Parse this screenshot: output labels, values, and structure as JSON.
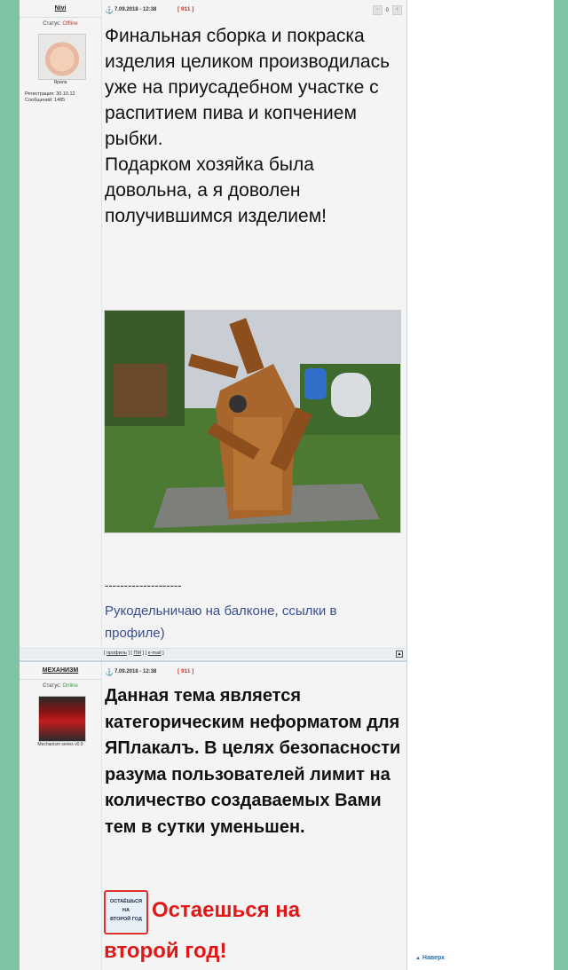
{
  "post1": {
    "username": "Nivi",
    "status_label": "Статус:",
    "status_value": "Offline",
    "avatar_caption": "Ярила",
    "registered": "Регистрация: 30.10.12",
    "messages": "Сообщений: 1485",
    "date": "7.09.2018 - 12:38",
    "post_number": "911",
    "rating": "0",
    "text_paragraphs": [
      "Финальная сборка и покраска изделия целиком производилась уже на приусадебном участке с распитием пива и копчением рыбки.",
      "Подарком хозяйка была довольна, а я доволен получившимся изделием!"
    ],
    "signature_separator": "--------------------",
    "signature": "Рукодельничаю на балконе, ссылки в профиле)",
    "footer_links": [
      "профиль",
      "ПМ",
      "e-mail"
    ]
  },
  "post2": {
    "username": "МЕХАНИЗМ",
    "status_label": "Статус:",
    "status_value": "Online",
    "avatar_caption": "Mechanism series v0.9",
    "date": "7.09.2018 - 12:38",
    "post_number": "911",
    "text": "Данная тема является категорическим неформатом для ЯПлакалъ. В целях безопасности разума пользователей лимит на количество создаваемых Вами тем в сутки уменьшен.",
    "badge_lines": [
      "ОСТАЁШЬСЯ",
      "НА",
      "ВТОРОЙ ГОД"
    ],
    "red_line1": "Остаешься на",
    "red_line2": "второй год!"
  },
  "nav": {
    "to_top": "Наверх"
  },
  "colors": {
    "background": "#7fc2a4",
    "offline": "#c0392b",
    "online": "#2e9d39",
    "signature": "#3b4f8f",
    "alert_red": "#e01818"
  }
}
